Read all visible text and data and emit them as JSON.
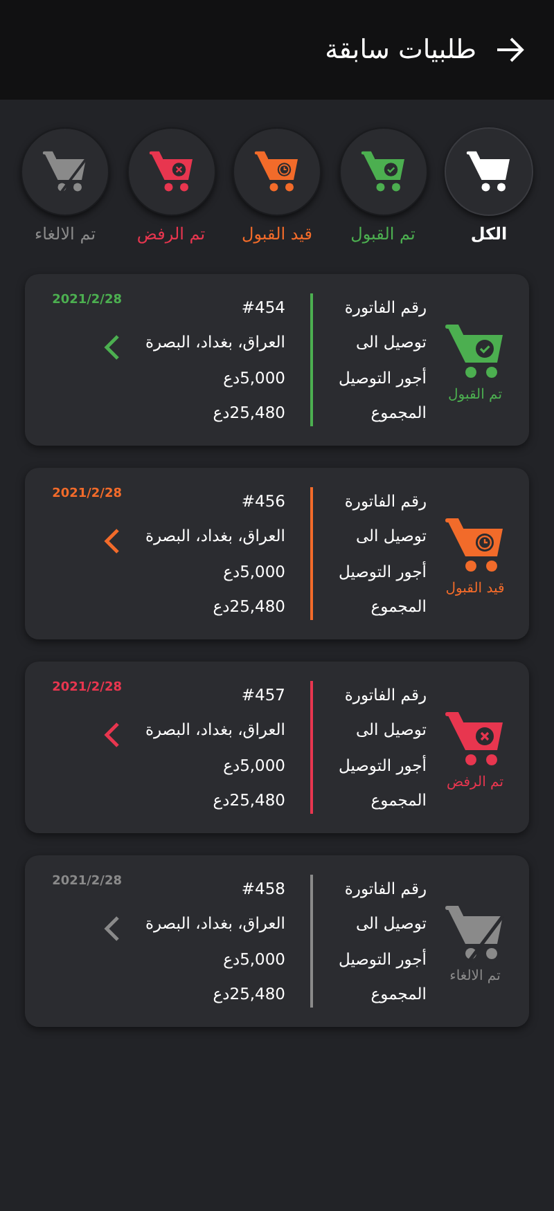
{
  "header": {
    "title": "طلبيات سابقة"
  },
  "filters": [
    {
      "kind": "all",
      "label": "الكل",
      "color": "#ffffff",
      "selected": true
    },
    {
      "kind": "accepted",
      "label": "تم القبول",
      "color": "#4caf50",
      "selected": false
    },
    {
      "kind": "pending",
      "label": "قيد القبول",
      "color": "#f26b2a",
      "selected": false
    },
    {
      "kind": "rejected",
      "label": "تم الرفض",
      "color": "#e8364f",
      "selected": false
    },
    {
      "kind": "cancelled",
      "label": "تم الالغاء",
      "color": "#8a8a8a",
      "selected": false
    }
  ],
  "orders": [
    {
      "kind": "accepted",
      "status": "تم القبول",
      "color": "#4caf50",
      "date": "2021/2/28",
      "fields": [
        {
          "label": "رقم الفاتورة",
          "value": "#454"
        },
        {
          "label": "توصيل الى",
          "value": "العراق، بغداد، البصرة"
        },
        {
          "label": "أجور التوصيل",
          "value": "5,000دع"
        },
        {
          "label": "المجموع",
          "value": "25,480دع"
        }
      ]
    },
    {
      "kind": "pending",
      "status": "قيد القبول",
      "color": "#f26b2a",
      "date": "2021/2/28",
      "fields": [
        {
          "label": "رقم الفاتورة",
          "value": "#456"
        },
        {
          "label": "توصيل الى",
          "value": "العراق، بغداد، البصرة"
        },
        {
          "label": "أجور التوصيل",
          "value": "5,000دع"
        },
        {
          "label": "المجموع",
          "value": "25,480دع"
        }
      ]
    },
    {
      "kind": "rejected",
      "status": "تم الرفض",
      "color": "#e8364f",
      "date": "2021/2/28",
      "fields": [
        {
          "label": "رقم الفاتورة",
          "value": "#457"
        },
        {
          "label": "توصيل الى",
          "value": "العراق، بغداد، البصرة"
        },
        {
          "label": "أجور التوصيل",
          "value": "5,000دع"
        },
        {
          "label": "المجموع",
          "value": "25,480دع"
        }
      ]
    },
    {
      "kind": "cancelled",
      "status": "تم الالغاء",
      "color": "#8a8a8a",
      "date": "2021/2/28",
      "fields": [
        {
          "label": "رقم الفاتورة",
          "value": "#458"
        },
        {
          "label": "توصيل الى",
          "value": "العراق، بغداد، البصرة"
        },
        {
          "label": "أجور التوصيل",
          "value": "5,000دع"
        },
        {
          "label": "المجموع",
          "value": "25,480دع"
        }
      ]
    }
  ]
}
